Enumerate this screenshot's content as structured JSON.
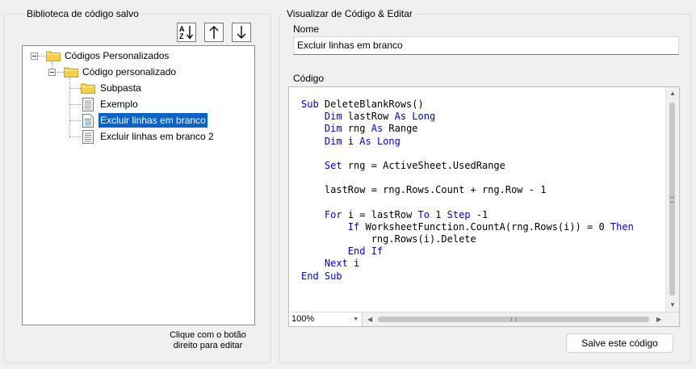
{
  "library": {
    "title": "Biblioteca de código salvo",
    "sort_buttons": [
      {
        "name": "sort-az-button",
        "icon": "sort-az-icon"
      },
      {
        "name": "move-up-button",
        "icon": "arrow-up-icon"
      },
      {
        "name": "move-down-button",
        "icon": "arrow-down-icon"
      }
    ],
    "tree": [
      {
        "label": "Códigos Personalizados",
        "type": "folder",
        "level": 0,
        "expanded": true,
        "selected": false
      },
      {
        "label": "Código personalizado",
        "type": "folder",
        "level": 1,
        "expanded": true,
        "selected": false
      },
      {
        "label": "Subpasta",
        "type": "folder",
        "level": 2,
        "selected": false
      },
      {
        "label": "Exemplo",
        "type": "document",
        "level": 2,
        "selected": false
      },
      {
        "label": "Excluir linhas em branco",
        "type": "document",
        "level": 2,
        "selected": true
      },
      {
        "label": "Excluir linhas em branco 2",
        "type": "document",
        "level": 2,
        "selected": false
      }
    ],
    "hint_line1": "Clique com o botão",
    "hint_line2": "direito para editar"
  },
  "editor": {
    "title": "Visualizar de Código & Editar",
    "name_label": "Nome",
    "name_value": "Excluir linhas em branco",
    "code_label": "Código",
    "code_lines": [
      [
        {
          "t": "Sub",
          "k": true
        },
        {
          "t": " DeleteBlankRows()"
        }
      ],
      [
        {
          "t": "    "
        },
        {
          "t": "Dim",
          "k": true
        },
        {
          "t": " lastRow "
        },
        {
          "t": "As Long",
          "k": true
        }
      ],
      [
        {
          "t": "    "
        },
        {
          "t": "Dim",
          "k": true
        },
        {
          "t": " rng "
        },
        {
          "t": "As",
          "k": true
        },
        {
          "t": " Range"
        }
      ],
      [
        {
          "t": "    "
        },
        {
          "t": "Dim",
          "k": true
        },
        {
          "t": " i "
        },
        {
          "t": "As Long",
          "k": true
        }
      ],
      [],
      [
        {
          "t": "    "
        },
        {
          "t": "Set",
          "k": true
        },
        {
          "t": " rng = ActiveSheet.UsedRange"
        }
      ],
      [],
      [
        {
          "t": "    lastRow = rng.Rows.Count + rng.Row - 1"
        }
      ],
      [],
      [
        {
          "t": "    "
        },
        {
          "t": "For",
          "k": true
        },
        {
          "t": " i = lastRow "
        },
        {
          "t": "To",
          "k": true
        },
        {
          "t": " 1 "
        },
        {
          "t": "Step",
          "k": true
        },
        {
          "t": " -1"
        }
      ],
      [
        {
          "t": "        "
        },
        {
          "t": "If",
          "k": true
        },
        {
          "t": " WorksheetFunction.CountA(rng.Rows(i)) = 0 "
        },
        {
          "t": "Then",
          "k": true
        }
      ],
      [
        {
          "t": "            rng.Rows(i).Delete"
        }
      ],
      [
        {
          "t": "        "
        },
        {
          "t": "End If",
          "k": true
        }
      ],
      [
        {
          "t": "    "
        },
        {
          "t": "Next",
          "k": true
        },
        {
          "t": " i"
        }
      ],
      [
        {
          "t": "End Sub",
          "k": true
        }
      ]
    ],
    "zoom": "100%",
    "save_label": "Salve este código"
  },
  "colors": {
    "keyword": "#0000e0",
    "selection": "#0a64c8",
    "folder": "#f7cf4c"
  }
}
